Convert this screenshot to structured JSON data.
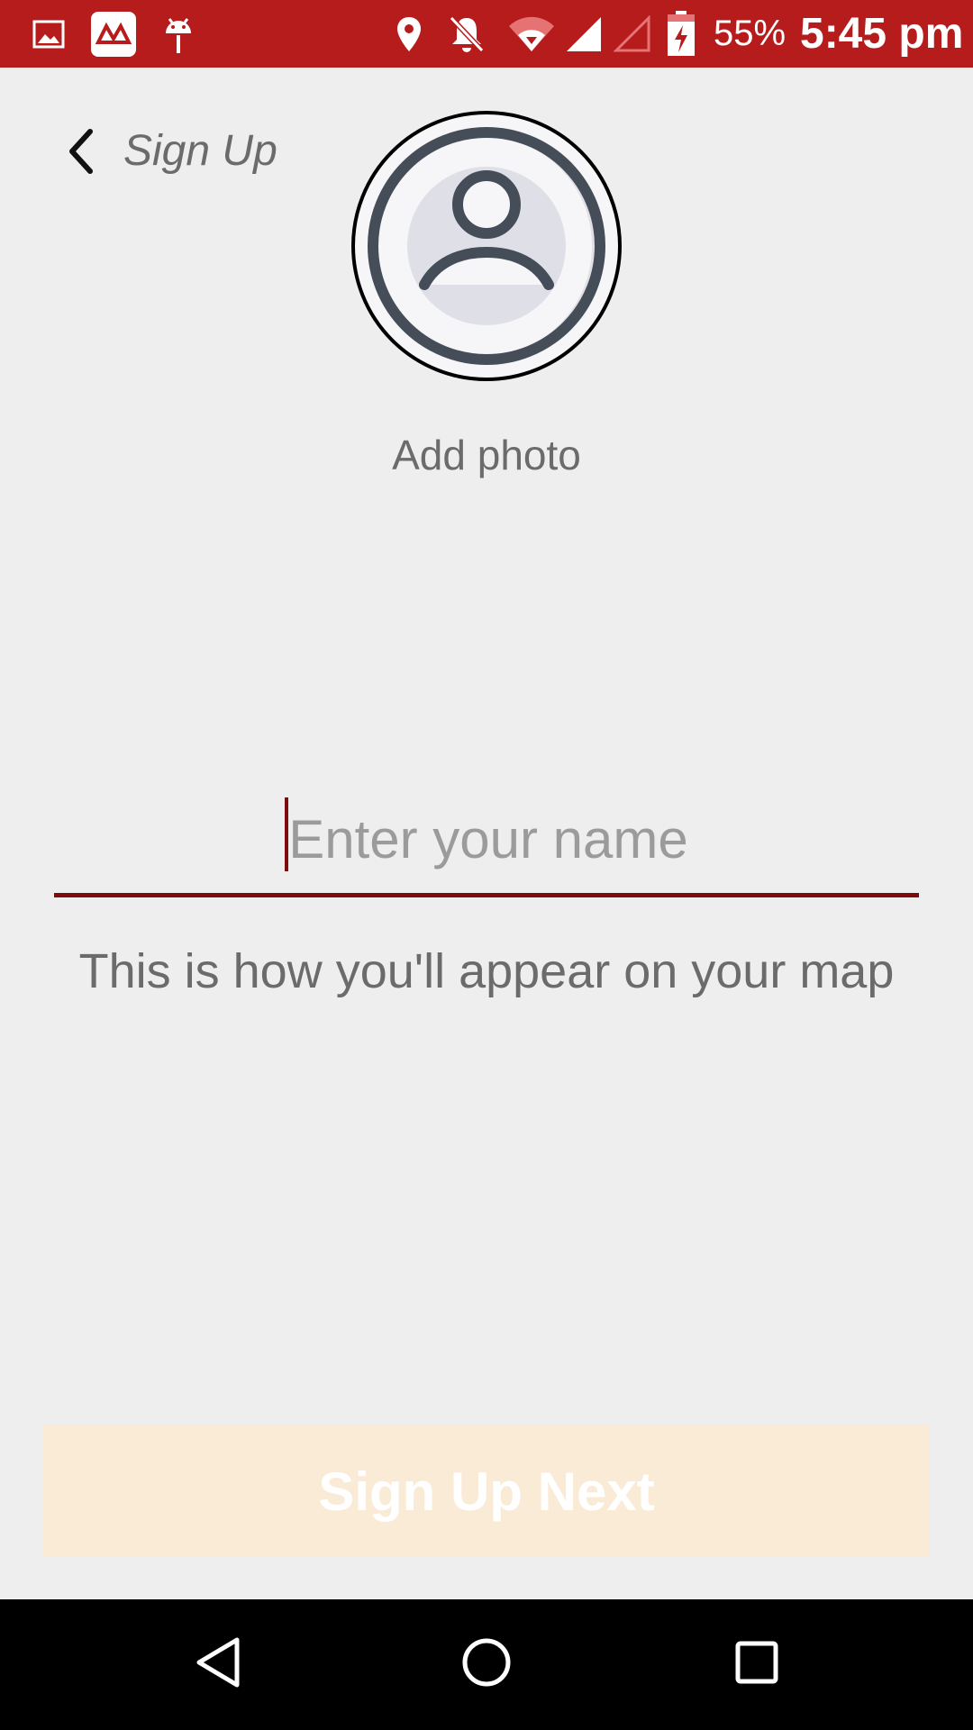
{
  "status_bar": {
    "battery_percent": "55%",
    "time": "5:45 pm",
    "background_color": "#b71c1c",
    "icons": [
      "image-icon",
      "app-notification-icon",
      "android-debug-icon",
      "location-icon",
      "notifications-off-icon",
      "wifi-icon",
      "signal-icon",
      "signal-empty-icon",
      "battery-charging-icon"
    ]
  },
  "header": {
    "back_icon": "chevron-left-icon",
    "title": "Sign Up"
  },
  "profile": {
    "avatar_icon": "user-avatar-icon",
    "add_photo_label": "Add photo"
  },
  "form": {
    "name_value": "",
    "name_placeholder": "Enter your name",
    "helper_text": "This is how you'll appear on your map",
    "accent_color": "#7f0c0c"
  },
  "actions": {
    "next_label": "Sign Up Next",
    "next_background": "#faebd7"
  },
  "nav_bar": {
    "icons": [
      "back-triangle-icon",
      "home-circle-icon",
      "recents-square-icon"
    ]
  }
}
